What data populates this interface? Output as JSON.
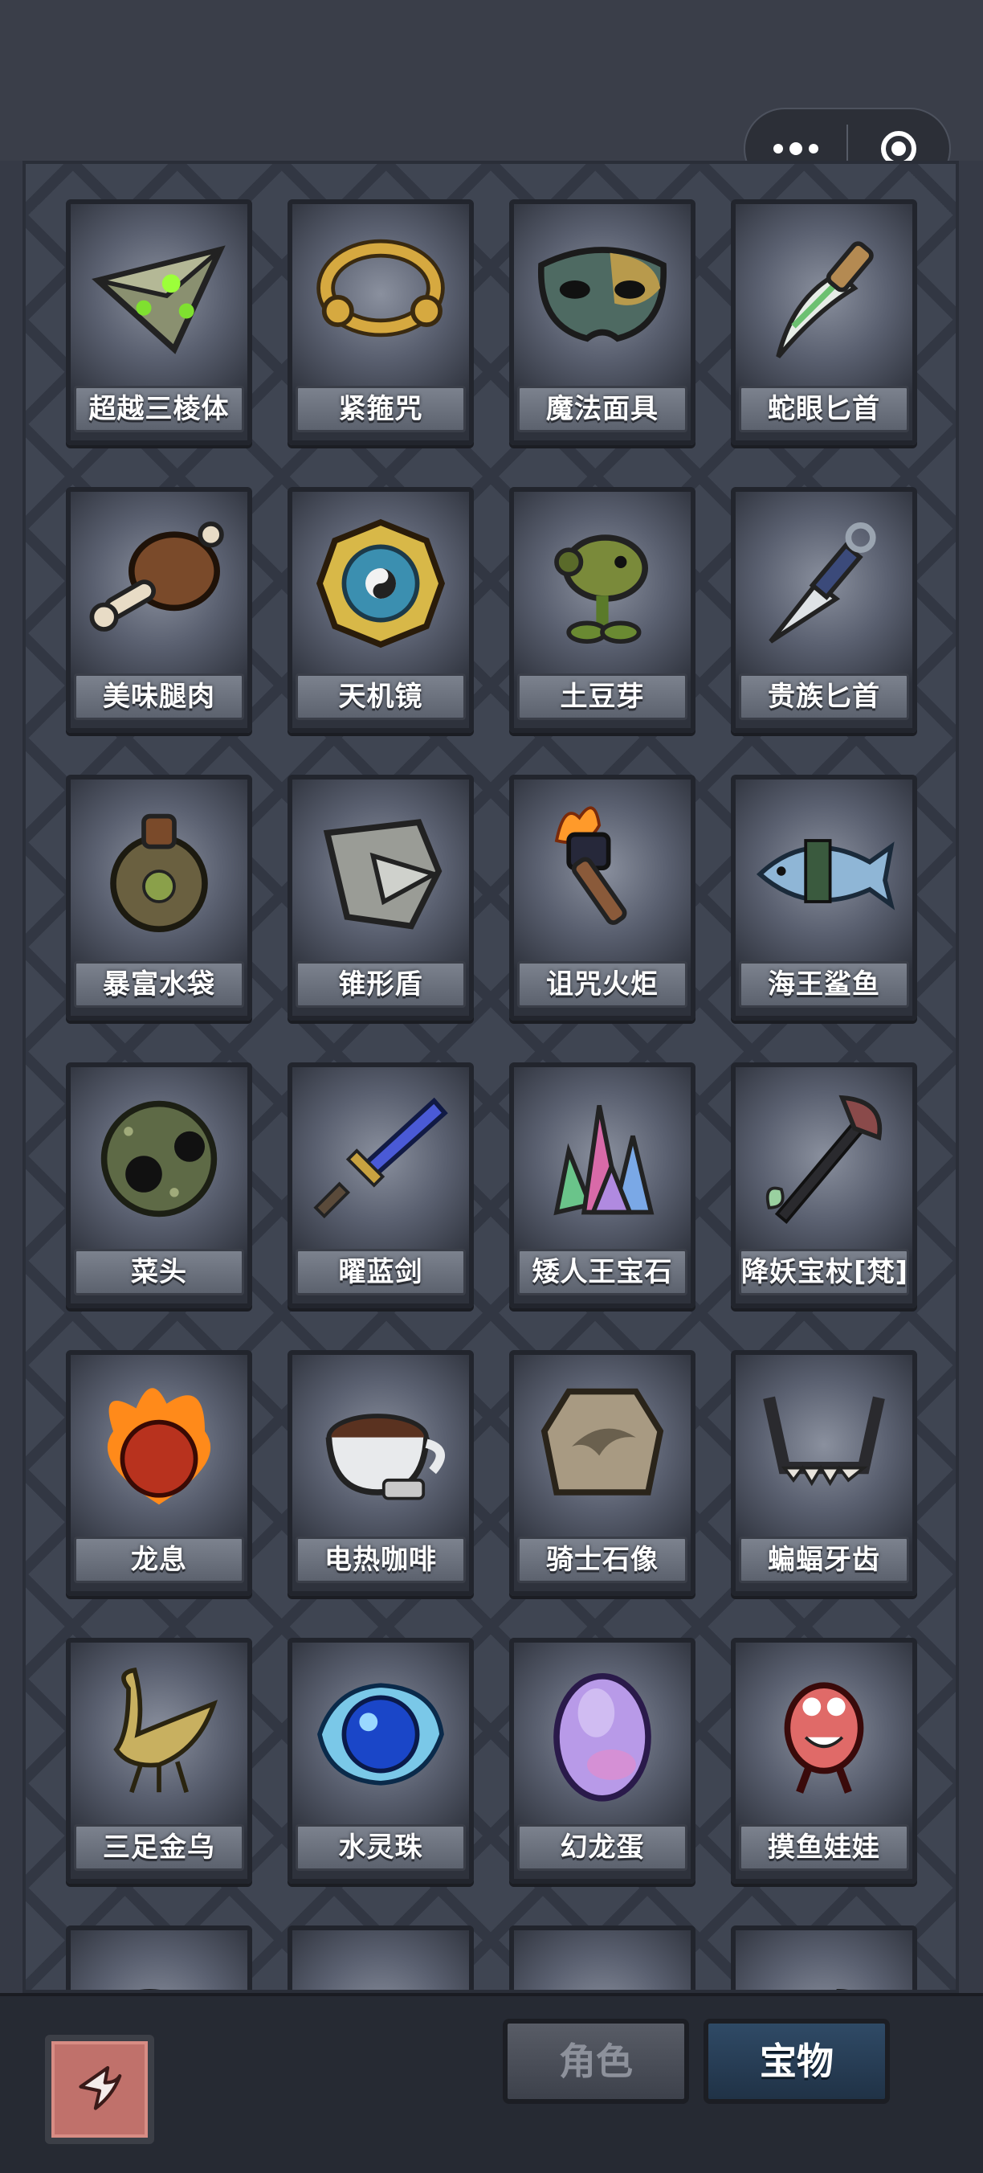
{
  "header": {
    "more_icon": "more-dots-icon",
    "close_icon": "target-circle-icon"
  },
  "treasures": [
    {
      "name": "超越三棱体",
      "icon": "pyramid-icon"
    },
    {
      "name": "紧箍咒",
      "icon": "golden-ring-icon"
    },
    {
      "name": "魔法面具",
      "icon": "mask-icon"
    },
    {
      "name": "蛇眼匕首",
      "icon": "curved-dagger-icon"
    },
    {
      "name": "美味腿肉",
      "icon": "meat-leg-icon"
    },
    {
      "name": "天机镜",
      "icon": "bagua-mirror-icon"
    },
    {
      "name": "土豆芽",
      "icon": "peashooter-icon"
    },
    {
      "name": "贵族匕首",
      "icon": "kunai-icon"
    },
    {
      "name": "暴富水袋",
      "icon": "water-pouch-icon"
    },
    {
      "name": "锥形盾",
      "icon": "cone-shield-icon"
    },
    {
      "name": "诅咒火炬",
      "icon": "torch-icon"
    },
    {
      "name": "海王鲨鱼",
      "icon": "shark-icon"
    },
    {
      "name": "菜头",
      "icon": "cabbage-head-icon"
    },
    {
      "name": "曜蓝剑",
      "icon": "blue-sword-icon"
    },
    {
      "name": "矮人王宝石",
      "icon": "crystal-gems-icon"
    },
    {
      "name": "降妖宝杖[梵]",
      "icon": "demon-staff-icon"
    },
    {
      "name": "龙息",
      "icon": "fire-heart-icon"
    },
    {
      "name": "电热咖啡",
      "icon": "coffee-cup-icon"
    },
    {
      "name": "骑士石像",
      "icon": "stone-tablet-icon"
    },
    {
      "name": "蝙蝠牙齿",
      "icon": "bat-fang-icon"
    },
    {
      "name": "三足金乌",
      "icon": "golden-bird-icon"
    },
    {
      "name": "水灵珠",
      "icon": "water-orb-icon"
    },
    {
      "name": "幻龙蛋",
      "icon": "dragon-egg-icon"
    },
    {
      "name": "摸鱼娃娃",
      "icon": "monster-doll-icon"
    },
    {
      "name": "",
      "icon": "partial-item-icon"
    },
    {
      "name": "",
      "icon": "partial-item-icon"
    },
    {
      "name": "",
      "icon": "partial-item-icon"
    },
    {
      "name": "",
      "icon": "partial-item-icon"
    }
  ],
  "footer": {
    "back_icon": "return-arrow-icon",
    "tab_role": "角色",
    "tab_treasure": "宝物",
    "active_tab": "宝物"
  }
}
